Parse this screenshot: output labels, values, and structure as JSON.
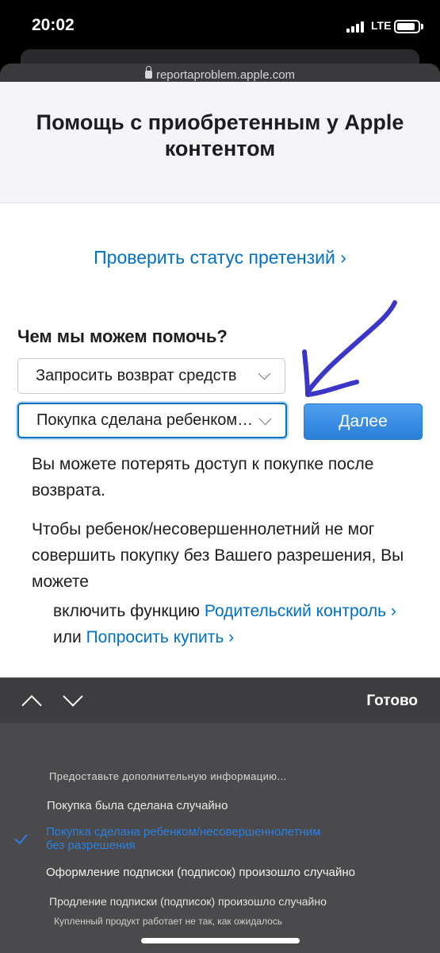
{
  "status_bar": {
    "time": "20:02",
    "network": "LTE"
  },
  "browser": {
    "url": "reportaproblem.apple.com"
  },
  "page": {
    "title": "Помощь с приобретенным у Apple контентом",
    "status_link": "Проверить статус претензий ›",
    "help_heading": "Чем мы можем помочь?",
    "select_request": "Запросить возврат средств",
    "select_reason": "Покупка сделана ребенком/несовершеннолетним без разрешения",
    "next_button": "Далее",
    "paragraph1": "Вы можете потерять доступ к покупке после возврата.",
    "paragraph2": "Чтобы ребенок/несовершеннолетний не мог совершить покупку без Вашего разрешения, Вы можете",
    "enable_text": "включить функцию ",
    "parental_control_link": "Родительский контроль ›",
    "or_text": "или ",
    "ask_to_buy_link": "Попросить купить ›"
  },
  "keyboard_toolbar": {
    "done_label": "Готово"
  },
  "picker": {
    "options": [
      "Предоставьте дополнительную информацию...",
      "Покупка была сделана случайно",
      "Покупка сделана ребенком/несовершеннолетним без разрешения",
      "Оформление подписки (подписок) произошло случайно",
      "Продление подписки (подписок) произошло случайно",
      "Купленный продукт работает не так, как ожидалось"
    ],
    "selected_index": 2
  },
  "colors": {
    "accent": "#0070c9",
    "picker_selected": "#2d7fe0",
    "annotation_arrow": "#3b35c8"
  }
}
